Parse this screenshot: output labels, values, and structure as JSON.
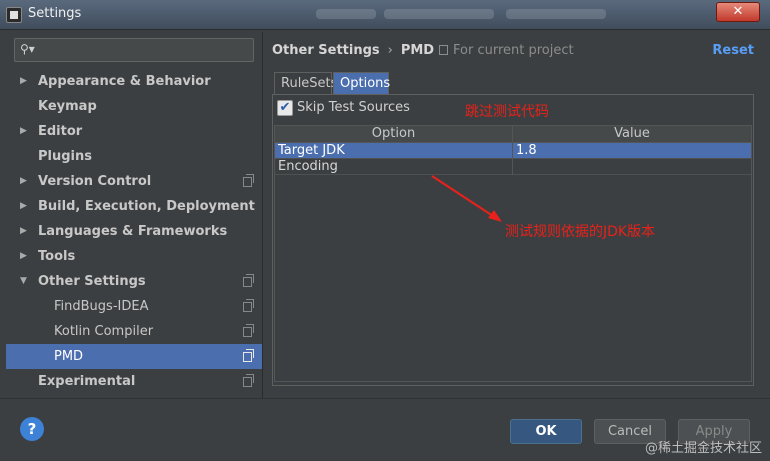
{
  "window": {
    "title": "Settings",
    "close_label": "✕"
  },
  "sidebar": {
    "search": {
      "value": "",
      "placeholder": ""
    },
    "items": [
      {
        "label": "Appearance & Behavior",
        "arrow": "▶",
        "copy": false
      },
      {
        "label": "Keymap",
        "arrow": "",
        "copy": false
      },
      {
        "label": "Editor",
        "arrow": "▶",
        "copy": false
      },
      {
        "label": "Plugins",
        "arrow": "",
        "copy": false
      },
      {
        "label": "Version Control",
        "arrow": "▶",
        "copy": true
      },
      {
        "label": "Build, Execution, Deployment",
        "arrow": "▶",
        "copy": false
      },
      {
        "label": "Languages & Frameworks",
        "arrow": "▶",
        "copy": false
      },
      {
        "label": "Tools",
        "arrow": "▶",
        "copy": false
      },
      {
        "label": "Other Settings",
        "arrow": "▼",
        "copy": true
      },
      {
        "label": "FindBugs-IDEA",
        "arrow": "",
        "copy": true
      },
      {
        "label": "Kotlin Compiler",
        "arrow": "",
        "copy": true
      },
      {
        "label": "PMD",
        "arrow": "",
        "copy": true
      },
      {
        "label": "Experimental",
        "arrow": "",
        "copy": true
      }
    ]
  },
  "header": {
    "breadcrumb_parent": "Other Settings",
    "breadcrumb_sep": "›",
    "breadcrumb_current": "PMD",
    "project_note": "For current project",
    "reset_label": "Reset"
  },
  "tabs": [
    {
      "label": "RuleSets",
      "active": false
    },
    {
      "label": "Options",
      "active": true
    }
  ],
  "options": {
    "skip_test_sources": {
      "label": "Skip Test Sources",
      "checked": true,
      "check_glyph": "✔"
    },
    "annotation_skip": "跳过测试代码",
    "table": {
      "columns": [
        "Option",
        "Value"
      ],
      "rows": [
        {
          "option": "Target JDK",
          "value": "1.8",
          "selected": true
        },
        {
          "option": "Encoding",
          "value": "",
          "selected": false
        }
      ]
    },
    "annotation_jdk": "测试规则依据的JDK版本"
  },
  "footer": {
    "help_label": "?",
    "ok_label": "OK",
    "cancel_label": "Cancel",
    "apply_label": "Apply",
    "watermark": "@稀土掘金技术社区"
  },
  "colors": {
    "accent": "#4b6eaf",
    "link": "#589df6",
    "annotation": "#e8211a",
    "background": "#3c3f41"
  }
}
